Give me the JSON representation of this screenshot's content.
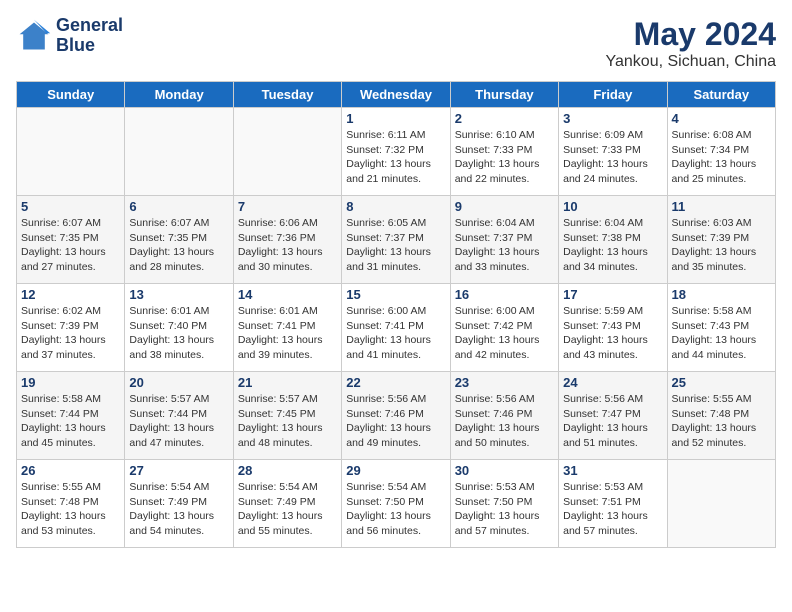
{
  "header": {
    "logo_line1": "General",
    "logo_line2": "Blue",
    "title": "May 2024",
    "subtitle": "Yankou, Sichuan, China"
  },
  "weekdays": [
    "Sunday",
    "Monday",
    "Tuesday",
    "Wednesday",
    "Thursday",
    "Friday",
    "Saturday"
  ],
  "weeks": [
    [
      {
        "day": null
      },
      {
        "day": null
      },
      {
        "day": null
      },
      {
        "day": "1",
        "sunrise": "Sunrise: 6:11 AM",
        "sunset": "Sunset: 7:32 PM",
        "daylight": "Daylight: 13 hours and 21 minutes."
      },
      {
        "day": "2",
        "sunrise": "Sunrise: 6:10 AM",
        "sunset": "Sunset: 7:33 PM",
        "daylight": "Daylight: 13 hours and 22 minutes."
      },
      {
        "day": "3",
        "sunrise": "Sunrise: 6:09 AM",
        "sunset": "Sunset: 7:33 PM",
        "daylight": "Daylight: 13 hours and 24 minutes."
      },
      {
        "day": "4",
        "sunrise": "Sunrise: 6:08 AM",
        "sunset": "Sunset: 7:34 PM",
        "daylight": "Daylight: 13 hours and 25 minutes."
      }
    ],
    [
      {
        "day": "5",
        "sunrise": "Sunrise: 6:07 AM",
        "sunset": "Sunset: 7:35 PM",
        "daylight": "Daylight: 13 hours and 27 minutes."
      },
      {
        "day": "6",
        "sunrise": "Sunrise: 6:07 AM",
        "sunset": "Sunset: 7:35 PM",
        "daylight": "Daylight: 13 hours and 28 minutes."
      },
      {
        "day": "7",
        "sunrise": "Sunrise: 6:06 AM",
        "sunset": "Sunset: 7:36 PM",
        "daylight": "Daylight: 13 hours and 30 minutes."
      },
      {
        "day": "8",
        "sunrise": "Sunrise: 6:05 AM",
        "sunset": "Sunset: 7:37 PM",
        "daylight": "Daylight: 13 hours and 31 minutes."
      },
      {
        "day": "9",
        "sunrise": "Sunrise: 6:04 AM",
        "sunset": "Sunset: 7:37 PM",
        "daylight": "Daylight: 13 hours and 33 minutes."
      },
      {
        "day": "10",
        "sunrise": "Sunrise: 6:04 AM",
        "sunset": "Sunset: 7:38 PM",
        "daylight": "Daylight: 13 hours and 34 minutes."
      },
      {
        "day": "11",
        "sunrise": "Sunrise: 6:03 AM",
        "sunset": "Sunset: 7:39 PM",
        "daylight": "Daylight: 13 hours and 35 minutes."
      }
    ],
    [
      {
        "day": "12",
        "sunrise": "Sunrise: 6:02 AM",
        "sunset": "Sunset: 7:39 PM",
        "daylight": "Daylight: 13 hours and 37 minutes."
      },
      {
        "day": "13",
        "sunrise": "Sunrise: 6:01 AM",
        "sunset": "Sunset: 7:40 PM",
        "daylight": "Daylight: 13 hours and 38 minutes."
      },
      {
        "day": "14",
        "sunrise": "Sunrise: 6:01 AM",
        "sunset": "Sunset: 7:41 PM",
        "daylight": "Daylight: 13 hours and 39 minutes."
      },
      {
        "day": "15",
        "sunrise": "Sunrise: 6:00 AM",
        "sunset": "Sunset: 7:41 PM",
        "daylight": "Daylight: 13 hours and 41 minutes."
      },
      {
        "day": "16",
        "sunrise": "Sunrise: 6:00 AM",
        "sunset": "Sunset: 7:42 PM",
        "daylight": "Daylight: 13 hours and 42 minutes."
      },
      {
        "day": "17",
        "sunrise": "Sunrise: 5:59 AM",
        "sunset": "Sunset: 7:43 PM",
        "daylight": "Daylight: 13 hours and 43 minutes."
      },
      {
        "day": "18",
        "sunrise": "Sunrise: 5:58 AM",
        "sunset": "Sunset: 7:43 PM",
        "daylight": "Daylight: 13 hours and 44 minutes."
      }
    ],
    [
      {
        "day": "19",
        "sunrise": "Sunrise: 5:58 AM",
        "sunset": "Sunset: 7:44 PM",
        "daylight": "Daylight: 13 hours and 45 minutes."
      },
      {
        "day": "20",
        "sunrise": "Sunrise: 5:57 AM",
        "sunset": "Sunset: 7:44 PM",
        "daylight": "Daylight: 13 hours and 47 minutes."
      },
      {
        "day": "21",
        "sunrise": "Sunrise: 5:57 AM",
        "sunset": "Sunset: 7:45 PM",
        "daylight": "Daylight: 13 hours and 48 minutes."
      },
      {
        "day": "22",
        "sunrise": "Sunrise: 5:56 AM",
        "sunset": "Sunset: 7:46 PM",
        "daylight": "Daylight: 13 hours and 49 minutes."
      },
      {
        "day": "23",
        "sunrise": "Sunrise: 5:56 AM",
        "sunset": "Sunset: 7:46 PM",
        "daylight": "Daylight: 13 hours and 50 minutes."
      },
      {
        "day": "24",
        "sunrise": "Sunrise: 5:56 AM",
        "sunset": "Sunset: 7:47 PM",
        "daylight": "Daylight: 13 hours and 51 minutes."
      },
      {
        "day": "25",
        "sunrise": "Sunrise: 5:55 AM",
        "sunset": "Sunset: 7:48 PM",
        "daylight": "Daylight: 13 hours and 52 minutes."
      }
    ],
    [
      {
        "day": "26",
        "sunrise": "Sunrise: 5:55 AM",
        "sunset": "Sunset: 7:48 PM",
        "daylight": "Daylight: 13 hours and 53 minutes."
      },
      {
        "day": "27",
        "sunrise": "Sunrise: 5:54 AM",
        "sunset": "Sunset: 7:49 PM",
        "daylight": "Daylight: 13 hours and 54 minutes."
      },
      {
        "day": "28",
        "sunrise": "Sunrise: 5:54 AM",
        "sunset": "Sunset: 7:49 PM",
        "daylight": "Daylight: 13 hours and 55 minutes."
      },
      {
        "day": "29",
        "sunrise": "Sunrise: 5:54 AM",
        "sunset": "Sunset: 7:50 PM",
        "daylight": "Daylight: 13 hours and 56 minutes."
      },
      {
        "day": "30",
        "sunrise": "Sunrise: 5:53 AM",
        "sunset": "Sunset: 7:50 PM",
        "daylight": "Daylight: 13 hours and 57 minutes."
      },
      {
        "day": "31",
        "sunrise": "Sunrise: 5:53 AM",
        "sunset": "Sunset: 7:51 PM",
        "daylight": "Daylight: 13 hours and 57 minutes."
      },
      {
        "day": null
      }
    ]
  ]
}
